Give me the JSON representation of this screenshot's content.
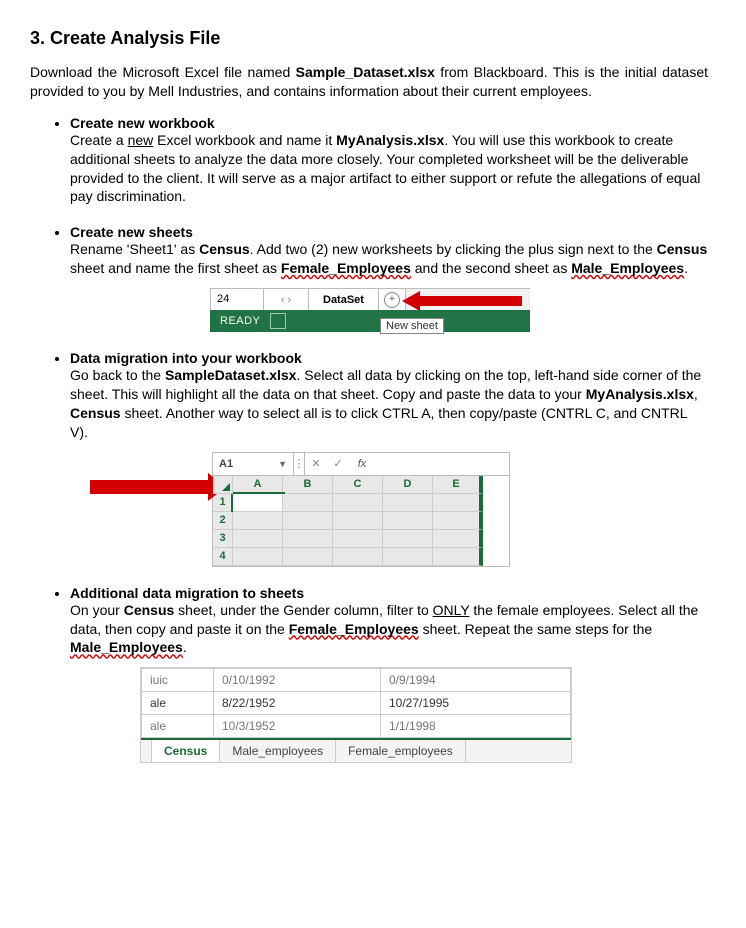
{
  "heading": "3. Create Analysis File",
  "intro_1": "Download the Microsoft Excel file named ",
  "intro_bold": "Sample_Dataset.xlsx",
  "intro_2": " from Blackboard.  This is the initial dataset provided to you by Mell Industries, and contains information about their current employees.",
  "step1": {
    "title": "Create new workbook",
    "p1": "Create a ",
    "underline": "new",
    "p2": " Excel workbook and name it ",
    "bold": "MyAnalysis.xlsx",
    "p3": ".  You will use this workbook to create additional sheets to analyze the data more closely.  Your completed worksheet will be the deliverable provided to the client.  It will serve as a major artifact to either support or refute the allegations of equal pay discrimination."
  },
  "step2": {
    "title": "Create new sheets",
    "p1": "Rename 'Sheet1' as ",
    "bold1": "Census",
    "p2": ".  Add two (2) new worksheets by clicking the plus sign next to the ",
    "bold2": "Census",
    "p3": " sheet and name the first sheet as ",
    "sq1": "Female_Employees",
    "p4": " and the second sheet as ",
    "sq2": "Male_Employees",
    "p5": "."
  },
  "fig1": {
    "cell": "24",
    "tab": "DataSet",
    "plus": "+",
    "ready": "READY",
    "tooltip": "New sheet"
  },
  "step3": {
    "title": "Data migration into your workbook",
    "p1": "Go back to the ",
    "bold1": "SampleDataset.xlsx",
    "p2": ". Select all data by clicking on the top, left-hand side corner of the sheet.  This will highlight all the data on that sheet. Copy and paste the data to your ",
    "bold2": "MyAnalysis.xlsx",
    "p2b": ", ",
    "bold3": "Census",
    "p3": " sheet. Another way to select all is to click CTRL A, then copy/paste (CNTRL C, and CNTRL V)."
  },
  "fig2": {
    "ref": "A1",
    "x": "✕",
    "check": "✓",
    "fx": "fx",
    "cols": [
      "A",
      "B",
      "C",
      "D",
      "E"
    ],
    "rows": [
      "1",
      "2",
      "3",
      "4"
    ]
  },
  "step4": {
    "title": "Additional data migration to sheets",
    "p1": "On your ",
    "bold1": "Census",
    "p2": " sheet, under the Gender column, filter to ",
    "under": "ONLY",
    "p3": " the female employees.  Select all the data, then copy and paste it on the ",
    "sq1": "Female_Employees",
    "p4": " sheet. Repeat the same steps for the ",
    "sq2": "Male_Employees",
    "p5": "."
  },
  "fig3": {
    "row0": {
      "c1": "iuic",
      "c2": "0/10/1992",
      "c3": "0/9/1994"
    },
    "row1": {
      "c1": "ale",
      "c2": "8/22/1952",
      "c3": "10/27/1995"
    },
    "row2": {
      "c1": "ale",
      "c2": "10/3/1952",
      "c3": "1/1/1998"
    },
    "tabs": [
      "Census",
      "Male_employees",
      "Female_employees"
    ]
  }
}
